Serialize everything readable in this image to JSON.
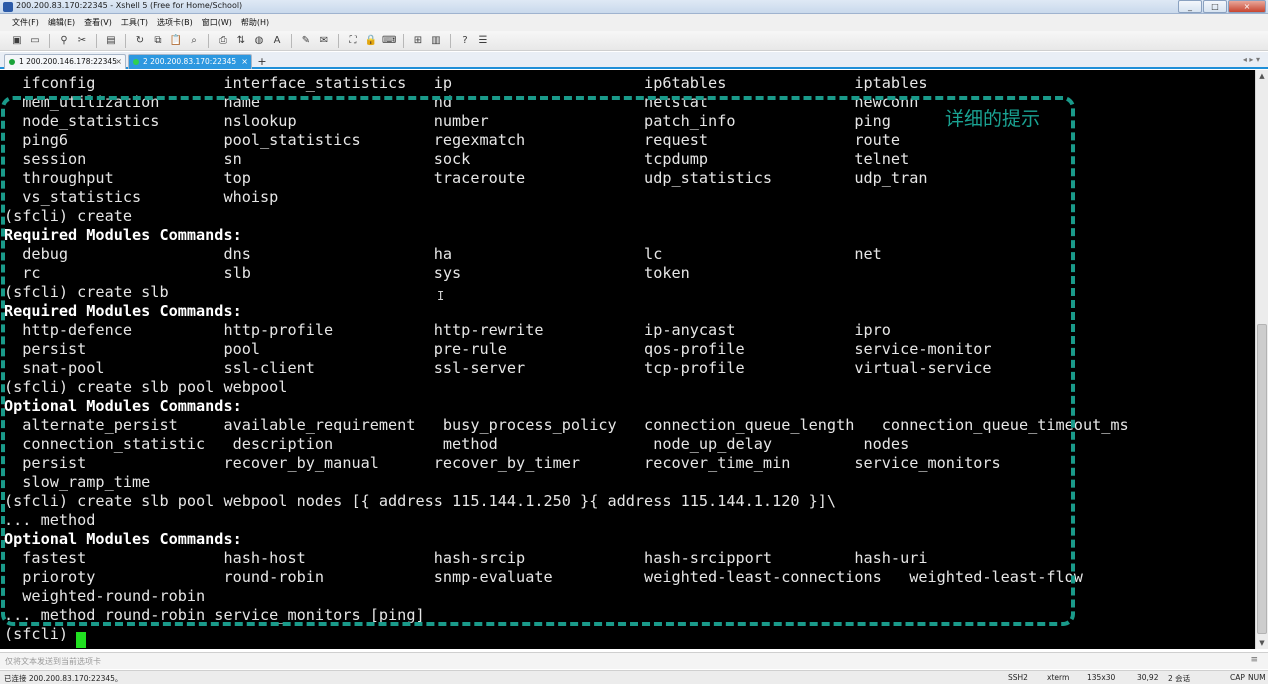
{
  "window": {
    "title": "200.200.83.170:22345 - Xshell 5 (Free for Home/School)",
    "controls": [
      "_",
      "□",
      "×"
    ]
  },
  "menu": [
    "文件(F)",
    "编辑(E)",
    "查看(V)",
    "工具(T)",
    "选项卡(B)",
    "窗口(W)",
    "帮助(H)"
  ],
  "tabs": [
    {
      "label": "1 200.200.146.178:22345",
      "close": "×"
    },
    {
      "label": "2 200.200.83.170:22345",
      "close": "×"
    }
  ],
  "tab_add": "+",
  "tab_nav": "◂ ▸ ▾",
  "terminal": {
    "lines": [
      {
        "text": "  ifconfig              interface_statistics   ip                     ip6tables              iptables",
        "bold": false
      },
      {
        "text": "  mem_utilization       name                   nd                     netstat                newconn",
        "bold": false
      },
      {
        "text": "  node_statistics       nslookup               number                 patch_info             ping",
        "bold": false
      },
      {
        "text": "  ping6                 pool_statistics        regexmatch             request                route",
        "bold": false
      },
      {
        "text": "  session               sn                     sock                   tcpdump                telnet",
        "bold": false
      },
      {
        "text": "  throughput            top                    traceroute             udp_statistics         udp_tran",
        "bold": false
      },
      {
        "text": "  vs_statistics         whoisp",
        "bold": false
      },
      {
        "text": "(sfcli) create",
        "bold": false
      },
      {
        "text": "Required Modules Commands:",
        "bold": true
      },
      {
        "text": "  debug                 dns                    ha                     lc                     net",
        "bold": false
      },
      {
        "text": "  rc                    slb                    sys                    token",
        "bold": false
      },
      {
        "text": "(sfcli) create slb",
        "bold": false
      },
      {
        "text": "Required Modules Commands:",
        "bold": true
      },
      {
        "text": "  http-defence          http-profile           http-rewrite           ip-anycast             ipro",
        "bold": false
      },
      {
        "text": "  persist               pool                   pre-rule               qos-profile            service-monitor",
        "bold": false
      },
      {
        "text": "  snat-pool             ssl-client             ssl-server             tcp-profile            virtual-service",
        "bold": false
      },
      {
        "text": "(sfcli) create slb pool webpool",
        "bold": false
      },
      {
        "text": "Optional Modules Commands:",
        "bold": true
      },
      {
        "text": "  alternate_persist     available_requirement   busy_process_policy   connection_queue_length   connection_queue_timeout_ms",
        "bold": false
      },
      {
        "text": "  connection_statistic   description            method                 node_up_delay          nodes",
        "bold": false
      },
      {
        "text": "  persist               recover_by_manual      recover_by_timer       recover_time_min       service_monitors",
        "bold": false
      },
      {
        "text": "  slow_ramp_time",
        "bold": false
      },
      {
        "text": "(sfcli) create slb pool webpool nodes [{ address 115.144.1.250 }{ address 115.144.1.120 }]\\",
        "bold": false
      },
      {
        "text": "... method",
        "bold": false
      },
      {
        "text": "Optional Modules Commands:",
        "bold": true
      },
      {
        "text": "  fastest               hash-host              hash-srcip             hash-srcipport         hash-uri",
        "bold": false
      },
      {
        "text": "  prioroty              round-robin            snmp-evaluate          weighted-least-connections   weighted-least-flow",
        "bold": false
      },
      {
        "text": "  weighted-round-robin",
        "bold": false
      },
      {
        "text": "... method round-robin service_monitors [ping]",
        "bold": false
      },
      {
        "text": "(sfcli) ",
        "bold": false
      }
    ],
    "cursor_color": "#21e021"
  },
  "annotation": {
    "label": "详细的提示",
    "color": "#1aa393"
  },
  "compose_bar": {
    "placeholder": "仅将文本发送到当前选项卡",
    "menu": "≡"
  },
  "status_bar": {
    "connection": "已连接 200.200.83.170:22345。",
    "protocol": "SSH2",
    "terminal_type": "xterm",
    "size": "135x30",
    "cursor_pos": "30,92",
    "sessions": "2 会话",
    "caps": "CAP",
    "num": "NUM"
  },
  "colors": {
    "terminal_bg": "#000000",
    "terminal_fg": "#e6e6e6",
    "active_tab": "#2d98e0"
  }
}
